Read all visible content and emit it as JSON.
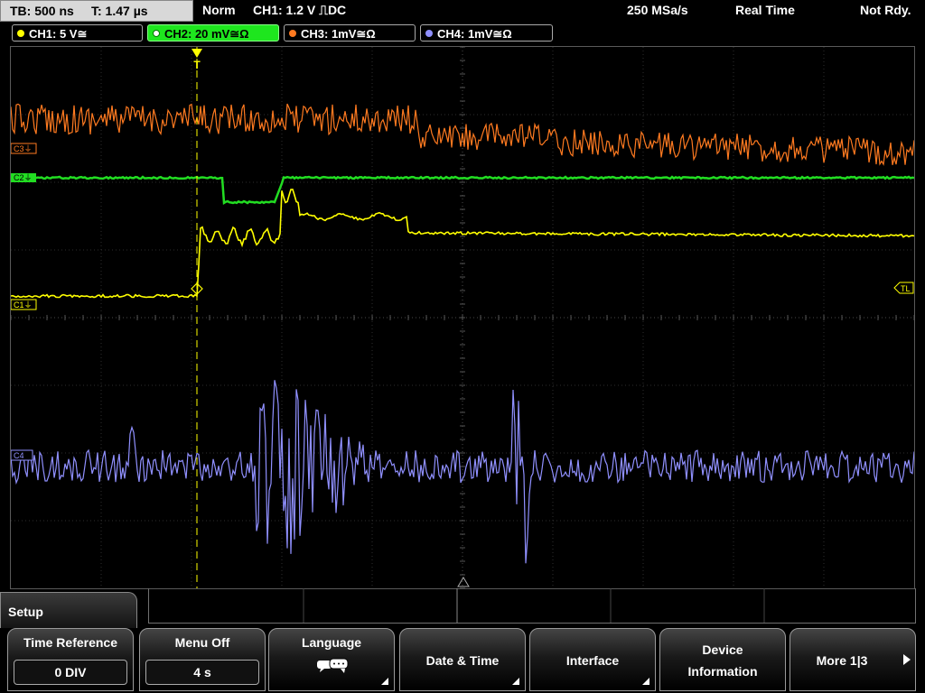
{
  "status_bar": {
    "timebase": "TB: 500 ns",
    "trigger_time": "T: 1.47 µs",
    "mode": "Norm",
    "trigger": "CH1: 1.2 V ⎍DC",
    "sample_rate": "250 MSa/s",
    "acquisition": "Real Time",
    "ready_state": "Not Rdy."
  },
  "channels": [
    {
      "label": "CH1: 5 V≅",
      "color": "#ffff00",
      "active": false
    },
    {
      "label": "CH2: 20 mV≅Ω",
      "color": "#22dd22",
      "active": true
    },
    {
      "label": "CH3: 1mV≅Ω",
      "color": "#ff7a20",
      "active": false
    },
    {
      "label": "CH4: 1mV≅Ω",
      "color": "#9090ff",
      "active": false
    }
  ],
  "scope_markers": {
    "c3": "C3⏚",
    "c2": "C2⏚",
    "c1": "C1⏚",
    "c4": "C4",
    "trigger_level": "TL",
    "trigger_marker": "T"
  },
  "menu": {
    "title": "Setup",
    "softkeys": [
      {
        "label": "Time Reference",
        "value": "0 DIV"
      },
      {
        "label": "Menu Off",
        "value": "4 s"
      },
      {
        "label": "Language",
        "icon": "speech-bubble-icon"
      },
      {
        "label": "Date & Time"
      },
      {
        "label": "Interface"
      },
      {
        "label": "Device",
        "label2": "Information"
      },
      {
        "label": "More 1|3"
      }
    ]
  }
}
